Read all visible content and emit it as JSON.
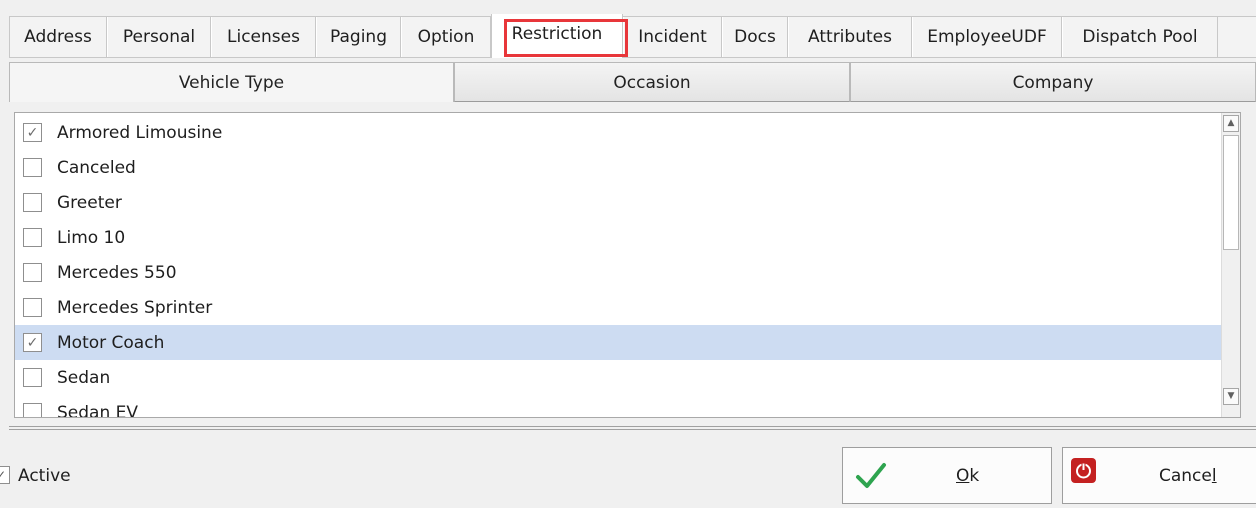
{
  "top_tabs": [
    "Address",
    "Personal",
    "Licenses",
    "Paging",
    "Option",
    "Restriction",
    "Incident",
    "Docs",
    "Attributes",
    "EmployeeUDF",
    "Dispatch Pool"
  ],
  "active_top_tab": "Restriction",
  "sub_tabs": [
    "Vehicle Type",
    "Occasion",
    "Company"
  ],
  "active_sub_tab": "Vehicle Type",
  "vehicle_types": [
    {
      "label": "Armored Limousine",
      "checked": true,
      "selected": false
    },
    {
      "label": "Canceled",
      "checked": false,
      "selected": false
    },
    {
      "label": "Greeter",
      "checked": false,
      "selected": false
    },
    {
      "label": "Limo 10",
      "checked": false,
      "selected": false
    },
    {
      "label": "Mercedes 550",
      "checked": false,
      "selected": false
    },
    {
      "label": "Mercedes Sprinter",
      "checked": false,
      "selected": false
    },
    {
      "label": "Motor Coach",
      "checked": true,
      "selected": true
    },
    {
      "label": "Sedan",
      "checked": false,
      "selected": false
    },
    {
      "label": "Sedan EV",
      "checked": false,
      "selected": false
    }
  ],
  "footer": {
    "active_label": "Active",
    "active_checked": true,
    "ok_label": "Ok",
    "cancel_label": "Cancel"
  },
  "icons": {
    "check_mark": "✓",
    "ok": "green-check-icon",
    "cancel": "red-power-icon",
    "scroll_up": "▲",
    "scroll_down": "▼"
  },
  "colors": {
    "highlight": "#e8363a",
    "selected_row": "#cddcf2",
    "ok_icon": "#2ea44f",
    "cancel_icon": "#c42121"
  }
}
